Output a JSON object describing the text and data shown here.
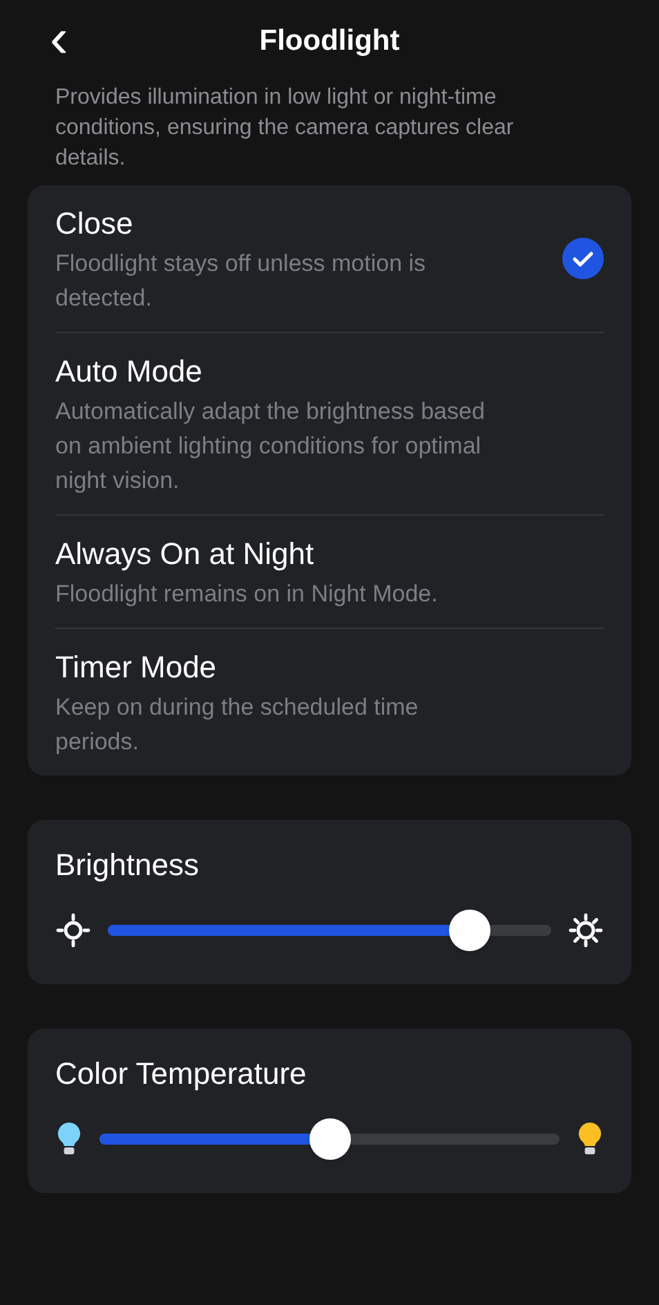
{
  "header": {
    "back": "‹",
    "title": "Floodlight"
  },
  "description": "Provides illumination in low light or night-time conditions, ensuring the camera captures clear details.",
  "modes": [
    {
      "title": "Close",
      "description": "Floodlight stays off unless motion is detected.",
      "selected": true
    },
    {
      "title": "Auto Mode",
      "description": "Automatically adapt the brightness based on ambient lighting conditions for optimal night vision.",
      "selected": false
    },
    {
      "title": "Always On at Night",
      "description": "Floodlight remains on in Night Mode.",
      "selected": false
    },
    {
      "title": "Timer Mode",
      "description": "Keep on during the scheduled time periods.",
      "selected": false
    }
  ],
  "sliders": [
    {
      "kind": "brightness",
      "title": "Brightness",
      "level": 0.815
    },
    {
      "kind": "temperature",
      "title": "Color Temperature",
      "level": 0.5
    }
  ]
}
